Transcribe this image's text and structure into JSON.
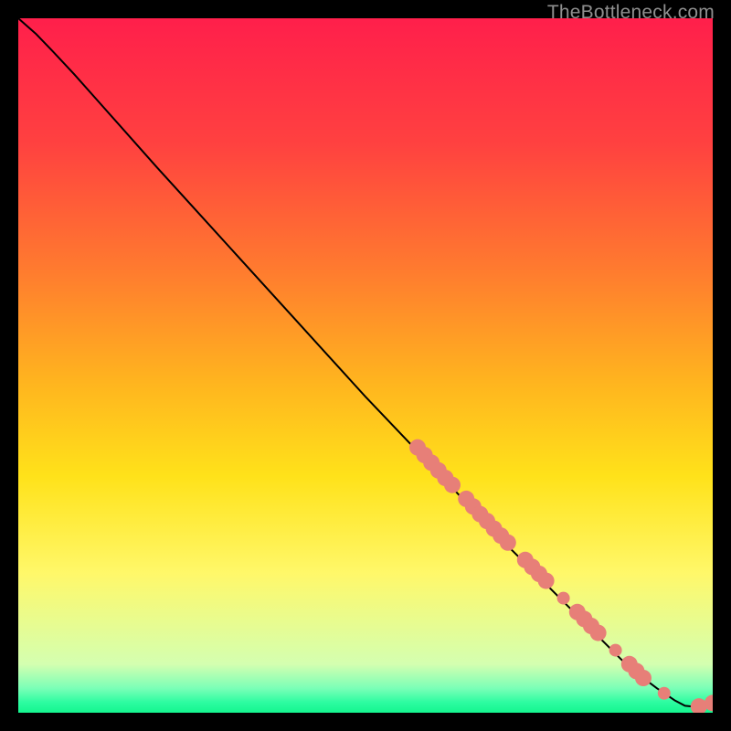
{
  "attribution": "TheBottleneck.com",
  "chart_data": {
    "type": "line",
    "title": "",
    "xlabel": "",
    "ylabel": "",
    "xlim": [
      0,
      100
    ],
    "ylim": [
      0,
      100
    ],
    "grid": false,
    "legend": false,
    "background_gradient_stops": [
      {
        "offset": 0.0,
        "color": "#ff1f4b"
      },
      {
        "offset": 0.18,
        "color": "#ff4140"
      },
      {
        "offset": 0.36,
        "color": "#ff7a2f"
      },
      {
        "offset": 0.52,
        "color": "#ffb31f"
      },
      {
        "offset": 0.66,
        "color": "#ffe21a"
      },
      {
        "offset": 0.8,
        "color": "#fff86a"
      },
      {
        "offset": 0.93,
        "color": "#d4ffb0"
      },
      {
        "offset": 0.965,
        "color": "#7affb7"
      },
      {
        "offset": 0.985,
        "color": "#2dfca1"
      },
      {
        "offset": 1.0,
        "color": "#14f58f"
      }
    ],
    "series": [
      {
        "name": "curve",
        "stroke": "#000000",
        "stroke_width": 2,
        "points": [
          {
            "x": 0.0,
            "y": 100.0
          },
          {
            "x": 2.5,
            "y": 97.8
          },
          {
            "x": 5.0,
            "y": 95.2
          },
          {
            "x": 8.0,
            "y": 92.0
          },
          {
            "x": 12.0,
            "y": 87.5
          },
          {
            "x": 20.0,
            "y": 78.5
          },
          {
            "x": 30.0,
            "y": 67.5
          },
          {
            "x": 40.0,
            "y": 56.5
          },
          {
            "x": 50.0,
            "y": 45.5
          },
          {
            "x": 60.0,
            "y": 35.0
          },
          {
            "x": 70.0,
            "y": 24.5
          },
          {
            "x": 80.0,
            "y": 14.5
          },
          {
            "x": 88.0,
            "y": 6.5
          },
          {
            "x": 92.0,
            "y": 3.5
          },
          {
            "x": 94.5,
            "y": 1.8
          },
          {
            "x": 96.0,
            "y": 1.0
          },
          {
            "x": 98.0,
            "y": 0.8
          },
          {
            "x": 100.0,
            "y": 0.9
          }
        ]
      }
    ],
    "markers": {
      "color": "#e77f78",
      "radius_major": 9,
      "radius_minor": 7,
      "points": [
        {
          "x": 57.5,
          "y": 38.2,
          "r": "major"
        },
        {
          "x": 58.5,
          "y": 37.1,
          "r": "major"
        },
        {
          "x": 59.5,
          "y": 36.0,
          "r": "major"
        },
        {
          "x": 60.5,
          "y": 34.9,
          "r": "major"
        },
        {
          "x": 61.5,
          "y": 33.8,
          "r": "major"
        },
        {
          "x": 62.5,
          "y": 32.8,
          "r": "major"
        },
        {
          "x": 64.5,
          "y": 30.8,
          "r": "major"
        },
        {
          "x": 65.5,
          "y": 29.7,
          "r": "major"
        },
        {
          "x": 66.5,
          "y": 28.6,
          "r": "major"
        },
        {
          "x": 67.5,
          "y": 27.6,
          "r": "major"
        },
        {
          "x": 68.5,
          "y": 26.5,
          "r": "major"
        },
        {
          "x": 69.5,
          "y": 25.5,
          "r": "major"
        },
        {
          "x": 70.5,
          "y": 24.5,
          "r": "major"
        },
        {
          "x": 73.0,
          "y": 22.0,
          "r": "major"
        },
        {
          "x": 74.0,
          "y": 21.0,
          "r": "major"
        },
        {
          "x": 75.0,
          "y": 20.0,
          "r": "major"
        },
        {
          "x": 76.0,
          "y": 19.0,
          "r": "major"
        },
        {
          "x": 78.5,
          "y": 16.5,
          "r": "minor"
        },
        {
          "x": 80.5,
          "y": 14.5,
          "r": "major"
        },
        {
          "x": 81.5,
          "y": 13.5,
          "r": "major"
        },
        {
          "x": 82.5,
          "y": 12.5,
          "r": "major"
        },
        {
          "x": 83.5,
          "y": 11.5,
          "r": "major"
        },
        {
          "x": 86.0,
          "y": 9.0,
          "r": "minor"
        },
        {
          "x": 88.0,
          "y": 7.0,
          "r": "major"
        },
        {
          "x": 89.0,
          "y": 6.0,
          "r": "major"
        },
        {
          "x": 90.0,
          "y": 5.0,
          "r": "major"
        },
        {
          "x": 93.0,
          "y": 2.8,
          "r": "minor"
        },
        {
          "x": 98.0,
          "y": 0.9,
          "r": "major"
        },
        {
          "x": 100.0,
          "y": 1.4,
          "r": "major"
        }
      ]
    }
  }
}
